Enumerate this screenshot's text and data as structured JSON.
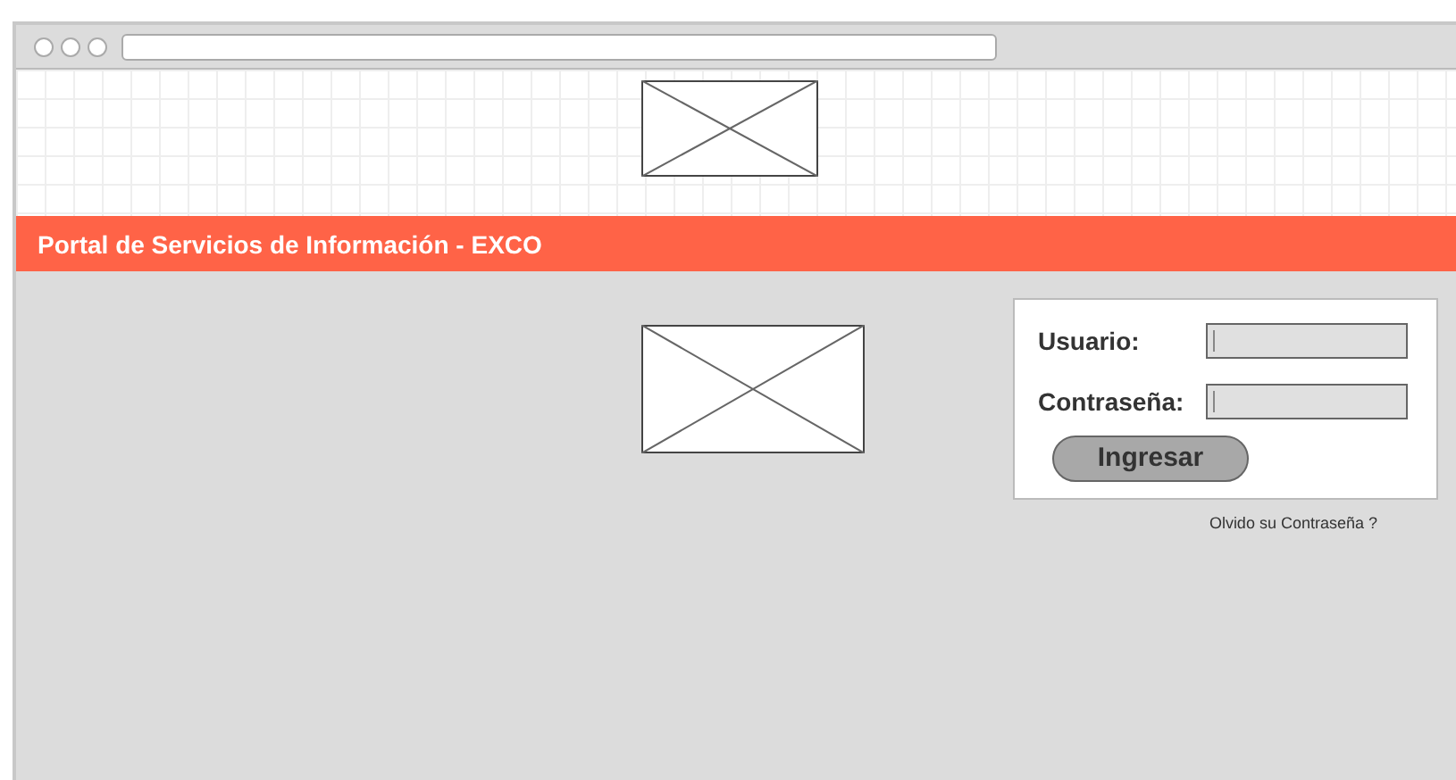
{
  "header": {
    "title": "Portal de Servicios de Información - EXCO"
  },
  "login": {
    "fields": [
      {
        "label": "Usuario:"
      },
      {
        "label": "Contraseña:"
      }
    ],
    "button": "Ingresar",
    "forgot_link": "Olvido su Contraseña ?"
  }
}
